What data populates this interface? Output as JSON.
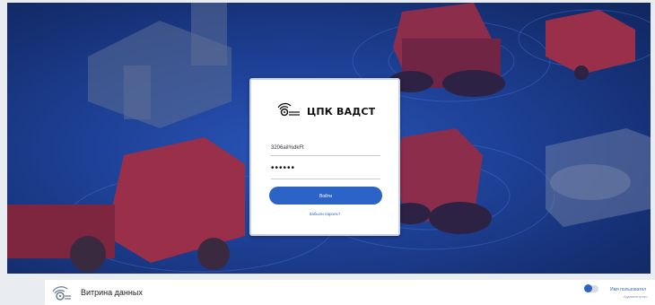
{
  "login": {
    "brand": "ЦПК ВАДСТ",
    "username_value": "3206aiI%dkFt",
    "password_masked": "••••••",
    "submit_label": "Войти",
    "forgot_link": "Забыли пароль?"
  },
  "footer": {
    "app_title": "Витрина данных",
    "user_name": "Имя пользовател",
    "user_role": "Администрато"
  },
  "colors": {
    "accent": "#2c63c7",
    "hero_bg": "#1d3f93",
    "machine_red": "#9a2f4a"
  }
}
